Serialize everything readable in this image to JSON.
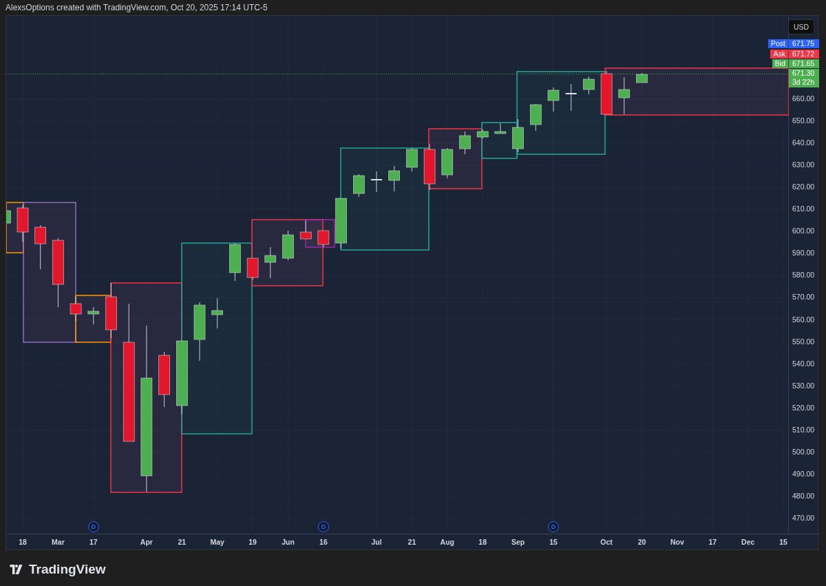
{
  "header": {
    "caption": "AlexsOptions created with TradingView.com, Oct 20, 2025 17:14 UTC-5"
  },
  "chart": {
    "currency_button": "USD",
    "price_tags": [
      {
        "label": "Post",
        "value": "671.75",
        "color": "#2962ff"
      },
      {
        "label": "Ask",
        "value": "671.72",
        "color": "#f23645"
      },
      {
        "label": "Bid",
        "value": "671.65",
        "color": "#4caf50"
      }
    ],
    "last_price": {
      "value": "671.30",
      "countdown": "3d 22h"
    },
    "price_axis": [
      "660.00",
      "650.00",
      "640.00",
      "630.00",
      "620.00",
      "610.00",
      "600.00",
      "590.00",
      "580.00",
      "570.00",
      "560.00",
      "550.00",
      "540.00",
      "530.00",
      "520.00",
      "510.00",
      "500.00",
      "490.00",
      "480.00",
      "470.00"
    ],
    "time_axis": [
      "18",
      "Mar",
      "17",
      "Apr",
      "21",
      "May",
      "19",
      "Jun",
      "16",
      "Jul",
      "21",
      "Aug",
      "18",
      "Sep",
      "15",
      "Oct",
      "20",
      "Nov",
      "17",
      "Dec",
      "15"
    ],
    "event_markers": [
      "D",
      "D",
      "D"
    ]
  },
  "footer": {
    "logo_text": "TradingView"
  }
}
